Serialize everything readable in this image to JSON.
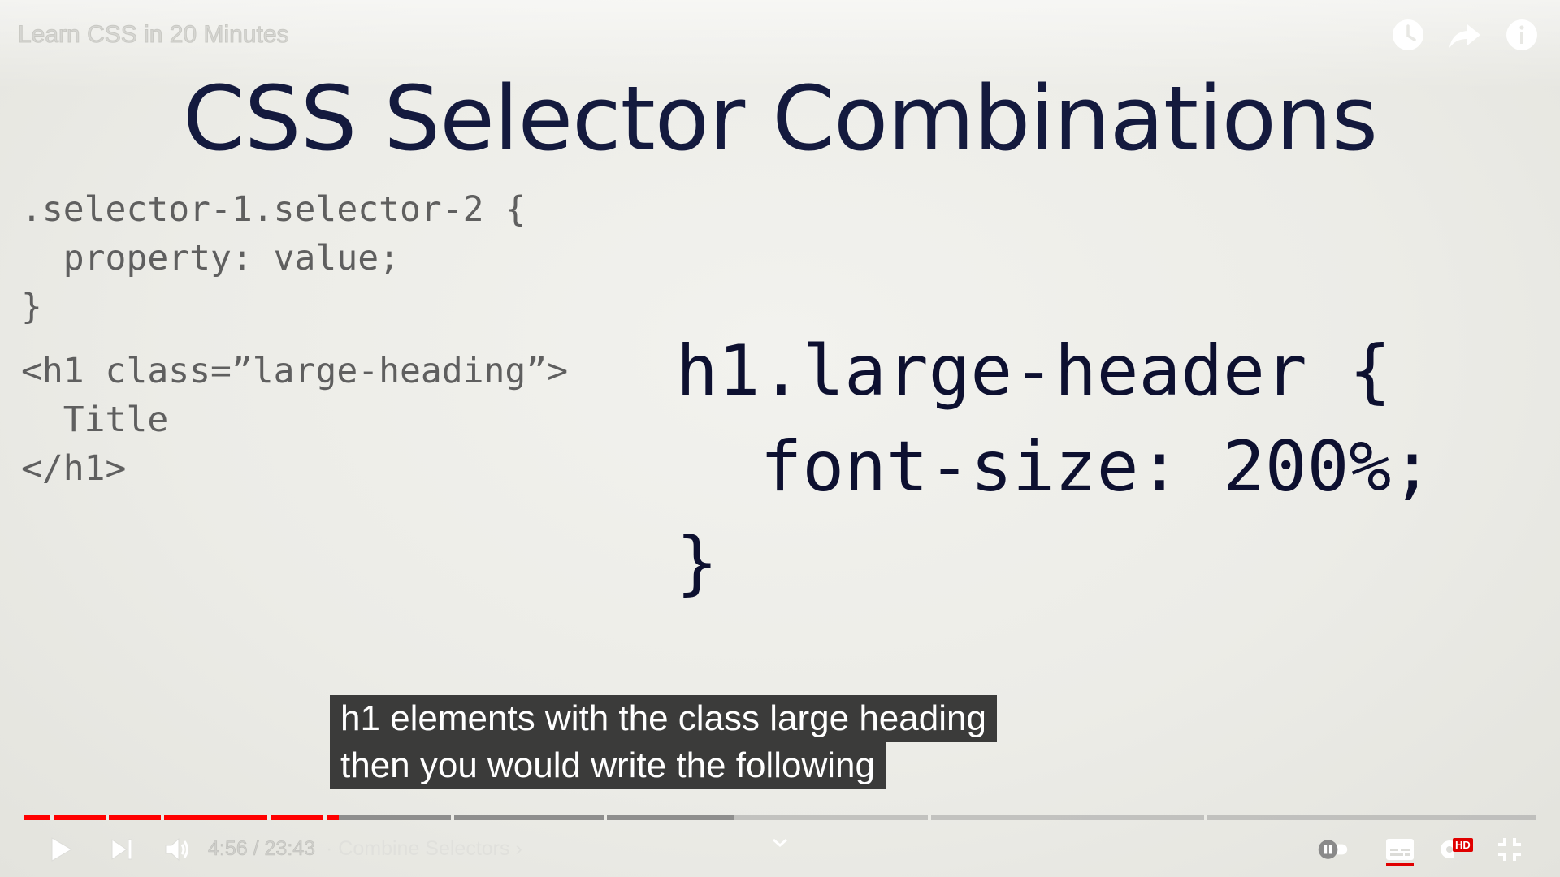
{
  "player": {
    "video_title": "Learn CSS in 20 Minutes",
    "icons": [
      "watch-later-icon",
      "share-icon",
      "info-icon",
      "play-icon",
      "next-icon",
      "volume-icon",
      "chevron-up-icon",
      "autoplay-toggle-icon",
      "subtitles-icon",
      "settings-icon",
      "exit-fullscreen-icon"
    ],
    "time_current": "4:56",
    "time_separator": " / ",
    "time_total": "23:43",
    "chapter_title": "· Combine Selectors",
    "chapter_chevron": "›",
    "hd_badge": "HD",
    "progress_fraction": 0.208,
    "accent_color": "#ff0000"
  },
  "slide": {
    "title": "CSS Selector Combinations",
    "code_general": ".selector-1.selector-2 {\n  property: value;\n}",
    "code_html": "<h1 class=”large-heading”>\n  Title\n</h1>",
    "code_example": "h1.large-header {\n  font-size: 200%;\n}"
  },
  "captions": {
    "line1": "h1 elements with the class large heading",
    "line2": "then you would write the following"
  }
}
